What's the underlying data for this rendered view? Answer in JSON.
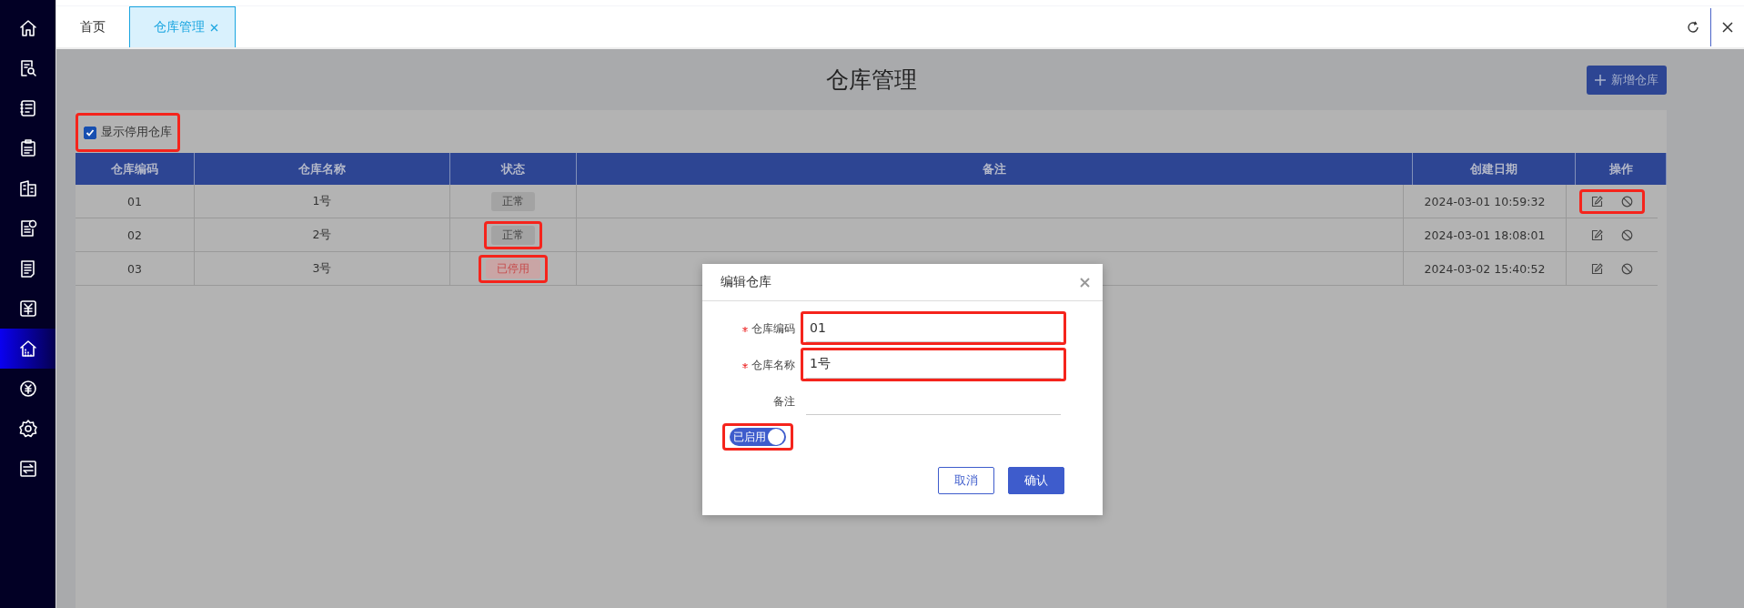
{
  "sidebar": {
    "items": [
      {
        "selected": false
      },
      {
        "selected": false
      },
      {
        "selected": false
      },
      {
        "selected": false
      },
      {
        "selected": false
      },
      {
        "selected": false
      },
      {
        "selected": false
      },
      {
        "selected": false
      },
      {
        "selected": true
      },
      {
        "selected": false
      },
      {
        "selected": false
      },
      {
        "selected": false
      }
    ]
  },
  "tabs": [
    {
      "label": "首页",
      "selected": false,
      "closable": false
    },
    {
      "label": "仓库管理",
      "selected": true,
      "closable": true
    }
  ],
  "page": {
    "title": "仓库管理",
    "add_button": "新增仓库"
  },
  "filter": {
    "label": "显示停用仓库",
    "checked": true,
    "highlighted": true
  },
  "table": {
    "columns": [
      "仓库编码",
      "仓库名称",
      "状态",
      "备注",
      "创建日期",
      "操作"
    ],
    "rows": [
      {
        "code": "01",
        "name": "1号",
        "status": {
          "label": "正常",
          "kind": "normal",
          "highlighted": false
        },
        "date": "2024-03-01 10:59:32",
        "actions_highlighted": true
      },
      {
        "code": "02",
        "name": "2号",
        "status": {
          "label": "正常",
          "kind": "normal",
          "highlighted": true
        },
        "date": "2024-03-01 18:08:01",
        "actions_highlighted": false
      },
      {
        "code": "03",
        "name": "3号",
        "status": {
          "label": "已停用",
          "kind": "disabled",
          "highlighted": true
        },
        "date": "2024-03-02 15:40:52",
        "actions_highlighted": false
      }
    ]
  },
  "dialog": {
    "title": "编辑仓库",
    "fields": [
      {
        "label": "仓库编码",
        "required": true,
        "value": "01",
        "highlighted": true
      },
      {
        "label": "仓库名称",
        "required": true,
        "value": "1号",
        "highlighted": true
      },
      {
        "label": "备注",
        "required": false,
        "highlighted": false
      }
    ],
    "toggle": {
      "label": "已启用",
      "on": true,
      "highlighted": true
    },
    "buttons": [
      {
        "label": "取消",
        "kind": "secondary"
      },
      {
        "label": "确认",
        "kind": "primary"
      }
    ]
  }
}
